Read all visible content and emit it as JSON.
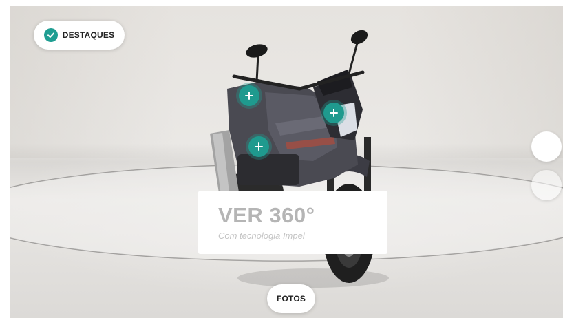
{
  "highlights_button": {
    "label": "DESTAQUES",
    "icon": "check-circle-icon",
    "accent": "#1f9e92"
  },
  "photos_button": {
    "label": "FOTOS"
  },
  "view360_card": {
    "title": "VER 360°",
    "subtitle": "Com tecnologia Impel"
  },
  "hotspots": [
    {
      "icon": "plus-icon"
    },
    {
      "icon": "plus-icon"
    },
    {
      "icon": "plus-icon"
    }
  ],
  "view_nav": {
    "count": 2,
    "active_index": 0
  },
  "colors": {
    "hotspot": "#1f9a8e",
    "background": "#e6e3df",
    "motorcycle_body": "#4a4a52"
  }
}
